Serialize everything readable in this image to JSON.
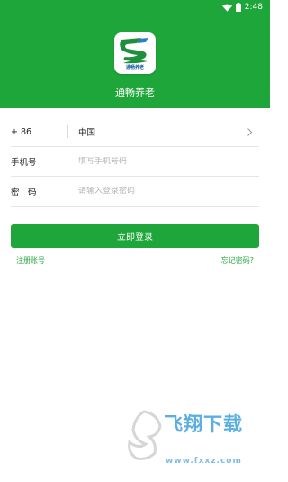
{
  "status_bar": {
    "time": "2:48"
  },
  "header": {
    "logo_caption": "通畅养老",
    "app_name": "通畅养老"
  },
  "form": {
    "country_code": "+ 86",
    "country_name": "中国",
    "phone_label": "手机号",
    "phone_placeholder": "填写手机号码",
    "password_label": "密　码",
    "password_placeholder": "请输入登录密码"
  },
  "actions": {
    "login_label": "立即登录",
    "register_label": "注册账号",
    "forgot_label": "忘记密码?"
  },
  "watermark": {
    "title": "飞翔下载",
    "url": "www.fxxz.com"
  },
  "colors": {
    "brand_green": "#1fa63a",
    "link_green": "#2aa844",
    "placeholder_gray": "#b3b3b3"
  }
}
